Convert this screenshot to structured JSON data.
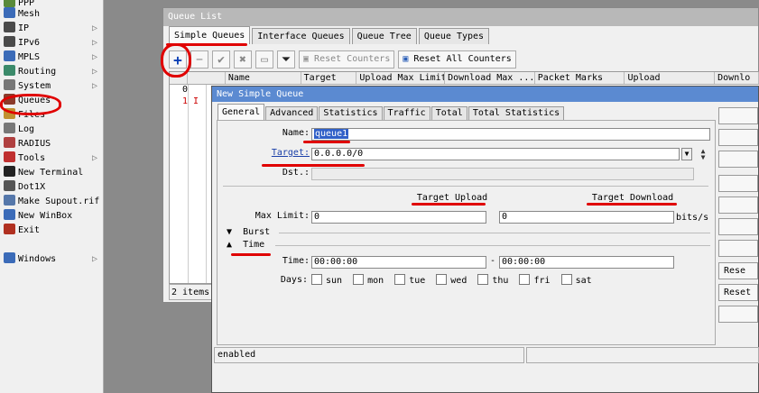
{
  "side_menu": {
    "items": [
      {
        "label": "PPP",
        "icon": "ppp-icon",
        "color": "#5a8a3a",
        "arrow": ""
      },
      {
        "label": "Mesh",
        "icon": "mesh-icon",
        "color": "#3b6bb8",
        "arrow": ""
      },
      {
        "label": "IP",
        "icon": "ip-icon",
        "color": "#4a4a4a",
        "arrow": "▷"
      },
      {
        "label": "IPv6",
        "icon": "ipv6-icon",
        "color": "#4a4a4a",
        "arrow": "▷"
      },
      {
        "label": "MPLS",
        "icon": "mpls-icon",
        "color": "#3b6bb8",
        "arrow": "▷"
      },
      {
        "label": "Routing",
        "icon": "routing-icon",
        "color": "#3b8a6a",
        "arrow": "▷"
      },
      {
        "label": "System",
        "icon": "system-icon",
        "color": "#777777",
        "arrow": "▷"
      },
      {
        "label": "Queues",
        "icon": "queues-icon",
        "color": "#8b3a2a",
        "arrow": ""
      },
      {
        "label": "Files",
        "icon": "files-icon",
        "color": "#c09030",
        "arrow": ""
      },
      {
        "label": "Log",
        "icon": "log-icon",
        "color": "#777777",
        "arrow": ""
      },
      {
        "label": "RADIUS",
        "icon": "radius-icon",
        "color": "#b04040",
        "arrow": ""
      },
      {
        "label": "Tools",
        "icon": "tools-icon",
        "color": "#c03030",
        "arrow": "▷"
      },
      {
        "label": "New Terminal",
        "icon": "terminal-icon",
        "color": "#222222",
        "arrow": ""
      },
      {
        "label": "Dot1X",
        "icon": "dot1x-icon",
        "color": "#555555",
        "arrow": ""
      },
      {
        "label": "Make Supout.rif",
        "icon": "supout-icon",
        "color": "#5577aa",
        "arrow": ""
      },
      {
        "label": "New WinBox",
        "icon": "winbox-icon",
        "color": "#3b6bb8",
        "arrow": ""
      },
      {
        "label": "Exit",
        "icon": "exit-icon",
        "color": "#b03020",
        "arrow": ""
      },
      {
        "label": "Windows",
        "icon": "windows-icon",
        "color": "#3b6bb8",
        "arrow": "▷"
      }
    ]
  },
  "queue_list": {
    "title": "Queue List",
    "tabs": [
      "Simple Queues",
      "Interface Queues",
      "Queue Tree",
      "Queue Types"
    ],
    "toolbar": {
      "add": "+",
      "remove": "−",
      "enable": "✔",
      "disable": "✖",
      "comment": "▭",
      "filter": "⏷",
      "reset_counters": "Reset Counters",
      "reset_all_counters": "Reset All Counters"
    },
    "columns": [
      "Name",
      "Target",
      "Upload Max Limit",
      "Download Max ...",
      "Packet Marks",
      "Upload",
      "Downlo"
    ],
    "rows": [
      {
        "num": "0",
        "flag": ""
      },
      {
        "num": "1",
        "flag": "I"
      }
    ],
    "count": "2 items"
  },
  "dialog": {
    "title": "New Simple Queue",
    "tabs": [
      "General",
      "Advanced",
      "Statistics",
      "Traffic",
      "Total",
      "Total Statistics"
    ],
    "name_label": "Name:",
    "name_value": "queue1",
    "target_label": "Target:",
    "target_value": "0.0.0.0/0",
    "dst_label": "Dst.:",
    "target_upload": "Target Upload",
    "target_download": "Target Download",
    "max_limit_label": "Max Limit:",
    "max_limit_upload": "0",
    "max_limit_download": "0",
    "unit": "bits/s",
    "burst_label": "Burst",
    "time_label": "Time",
    "time_field_label": "Time:",
    "time_from": "00:00:00",
    "time_dash": "-",
    "time_to": "00:00:00",
    "days_label": "Days:",
    "days": [
      "sun",
      "mon",
      "tue",
      "wed",
      "thu",
      "fri",
      "sat"
    ],
    "side_buttons": [
      "",
      "",
      "",
      "",
      "",
      "",
      "",
      "Rese",
      "Reset",
      ""
    ],
    "status": "enabled"
  },
  "colors": {
    "annotation": "#e00000",
    "dialog_title": "#5b8ad1",
    "link_blue": "#1a3fa8"
  }
}
